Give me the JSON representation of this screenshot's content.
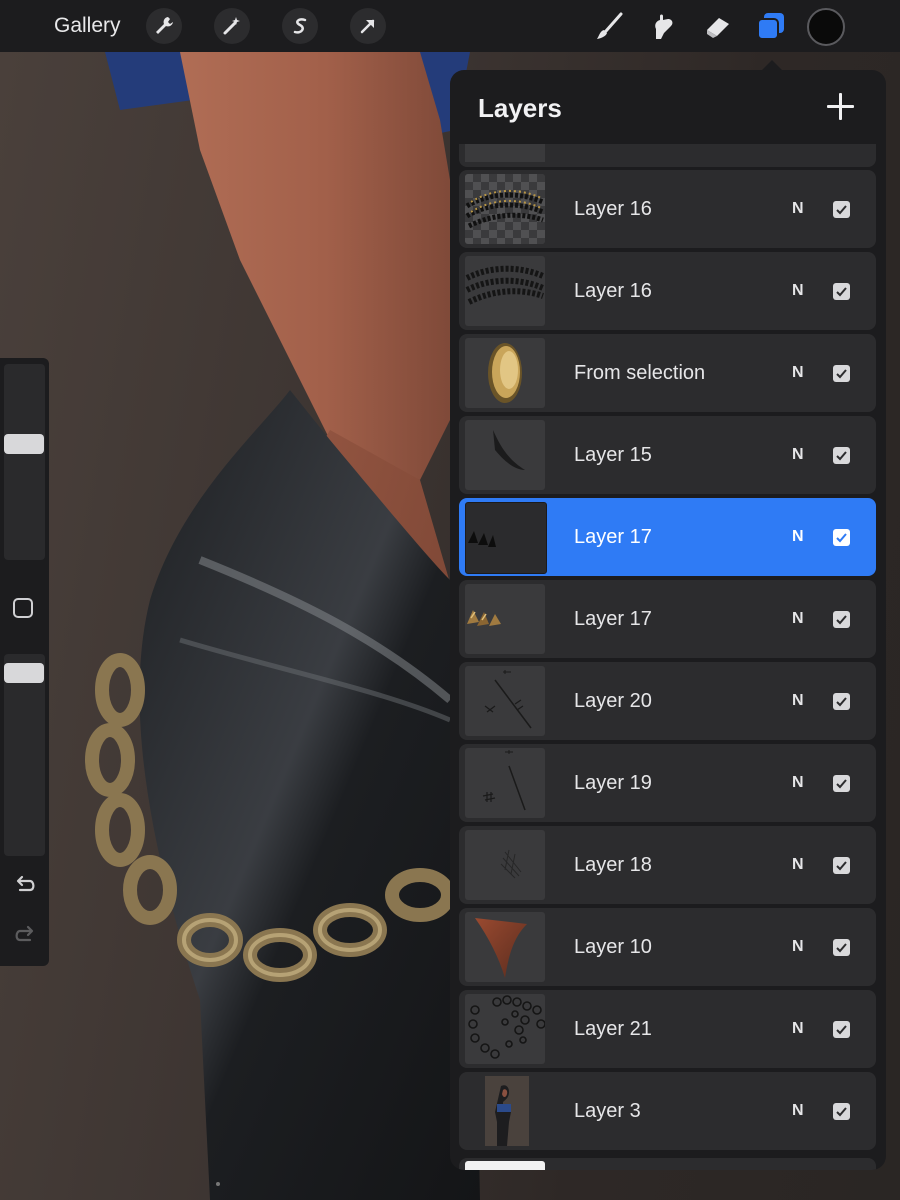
{
  "toolbar": {
    "gallery_label": "Gallery",
    "left_tools": [
      "wrench-icon",
      "magic-wand-icon",
      "selection-s-icon",
      "transform-arrow-icon"
    ],
    "right_tools": [
      "brush-icon",
      "smudge-icon",
      "eraser-icon",
      "layers-icon"
    ],
    "active_tool": "layers-icon",
    "current_color": "#0a0a0a",
    "accent_color": "#2f7bf5"
  },
  "sidebar": {
    "brush_size_level": 0.6,
    "opacity_level": 0.95,
    "undo_icon": "undo-icon",
    "redo_icon": "redo-icon"
  },
  "layers_panel": {
    "title": "Layers",
    "add_icon": "plus-icon",
    "layers": [
      {
        "name": "Layer 16",
        "blend": "N",
        "visible": true,
        "selected": false
      },
      {
        "name": "Layer 16",
        "blend": "N",
        "visible": true,
        "selected": false
      },
      {
        "name": "From selection",
        "blend": "N",
        "visible": true,
        "selected": false
      },
      {
        "name": "Layer 15",
        "blend": "N",
        "visible": true,
        "selected": false
      },
      {
        "name": "Layer 17",
        "blend": "N",
        "visible": true,
        "selected": true
      },
      {
        "name": "Layer 17",
        "blend": "N",
        "visible": true,
        "selected": false
      },
      {
        "name": "Layer 20",
        "blend": "N",
        "visible": true,
        "selected": false
      },
      {
        "name": "Layer 19",
        "blend": "N",
        "visible": true,
        "selected": false
      },
      {
        "name": "Layer 18",
        "blend": "N",
        "visible": true,
        "selected": false
      },
      {
        "name": "Layer 10",
        "blend": "N",
        "visible": true,
        "selected": false
      },
      {
        "name": "Layer 21",
        "blend": "N",
        "visible": true,
        "selected": false
      },
      {
        "name": "Layer 3",
        "blend": "N",
        "visible": true,
        "selected": false
      }
    ]
  }
}
